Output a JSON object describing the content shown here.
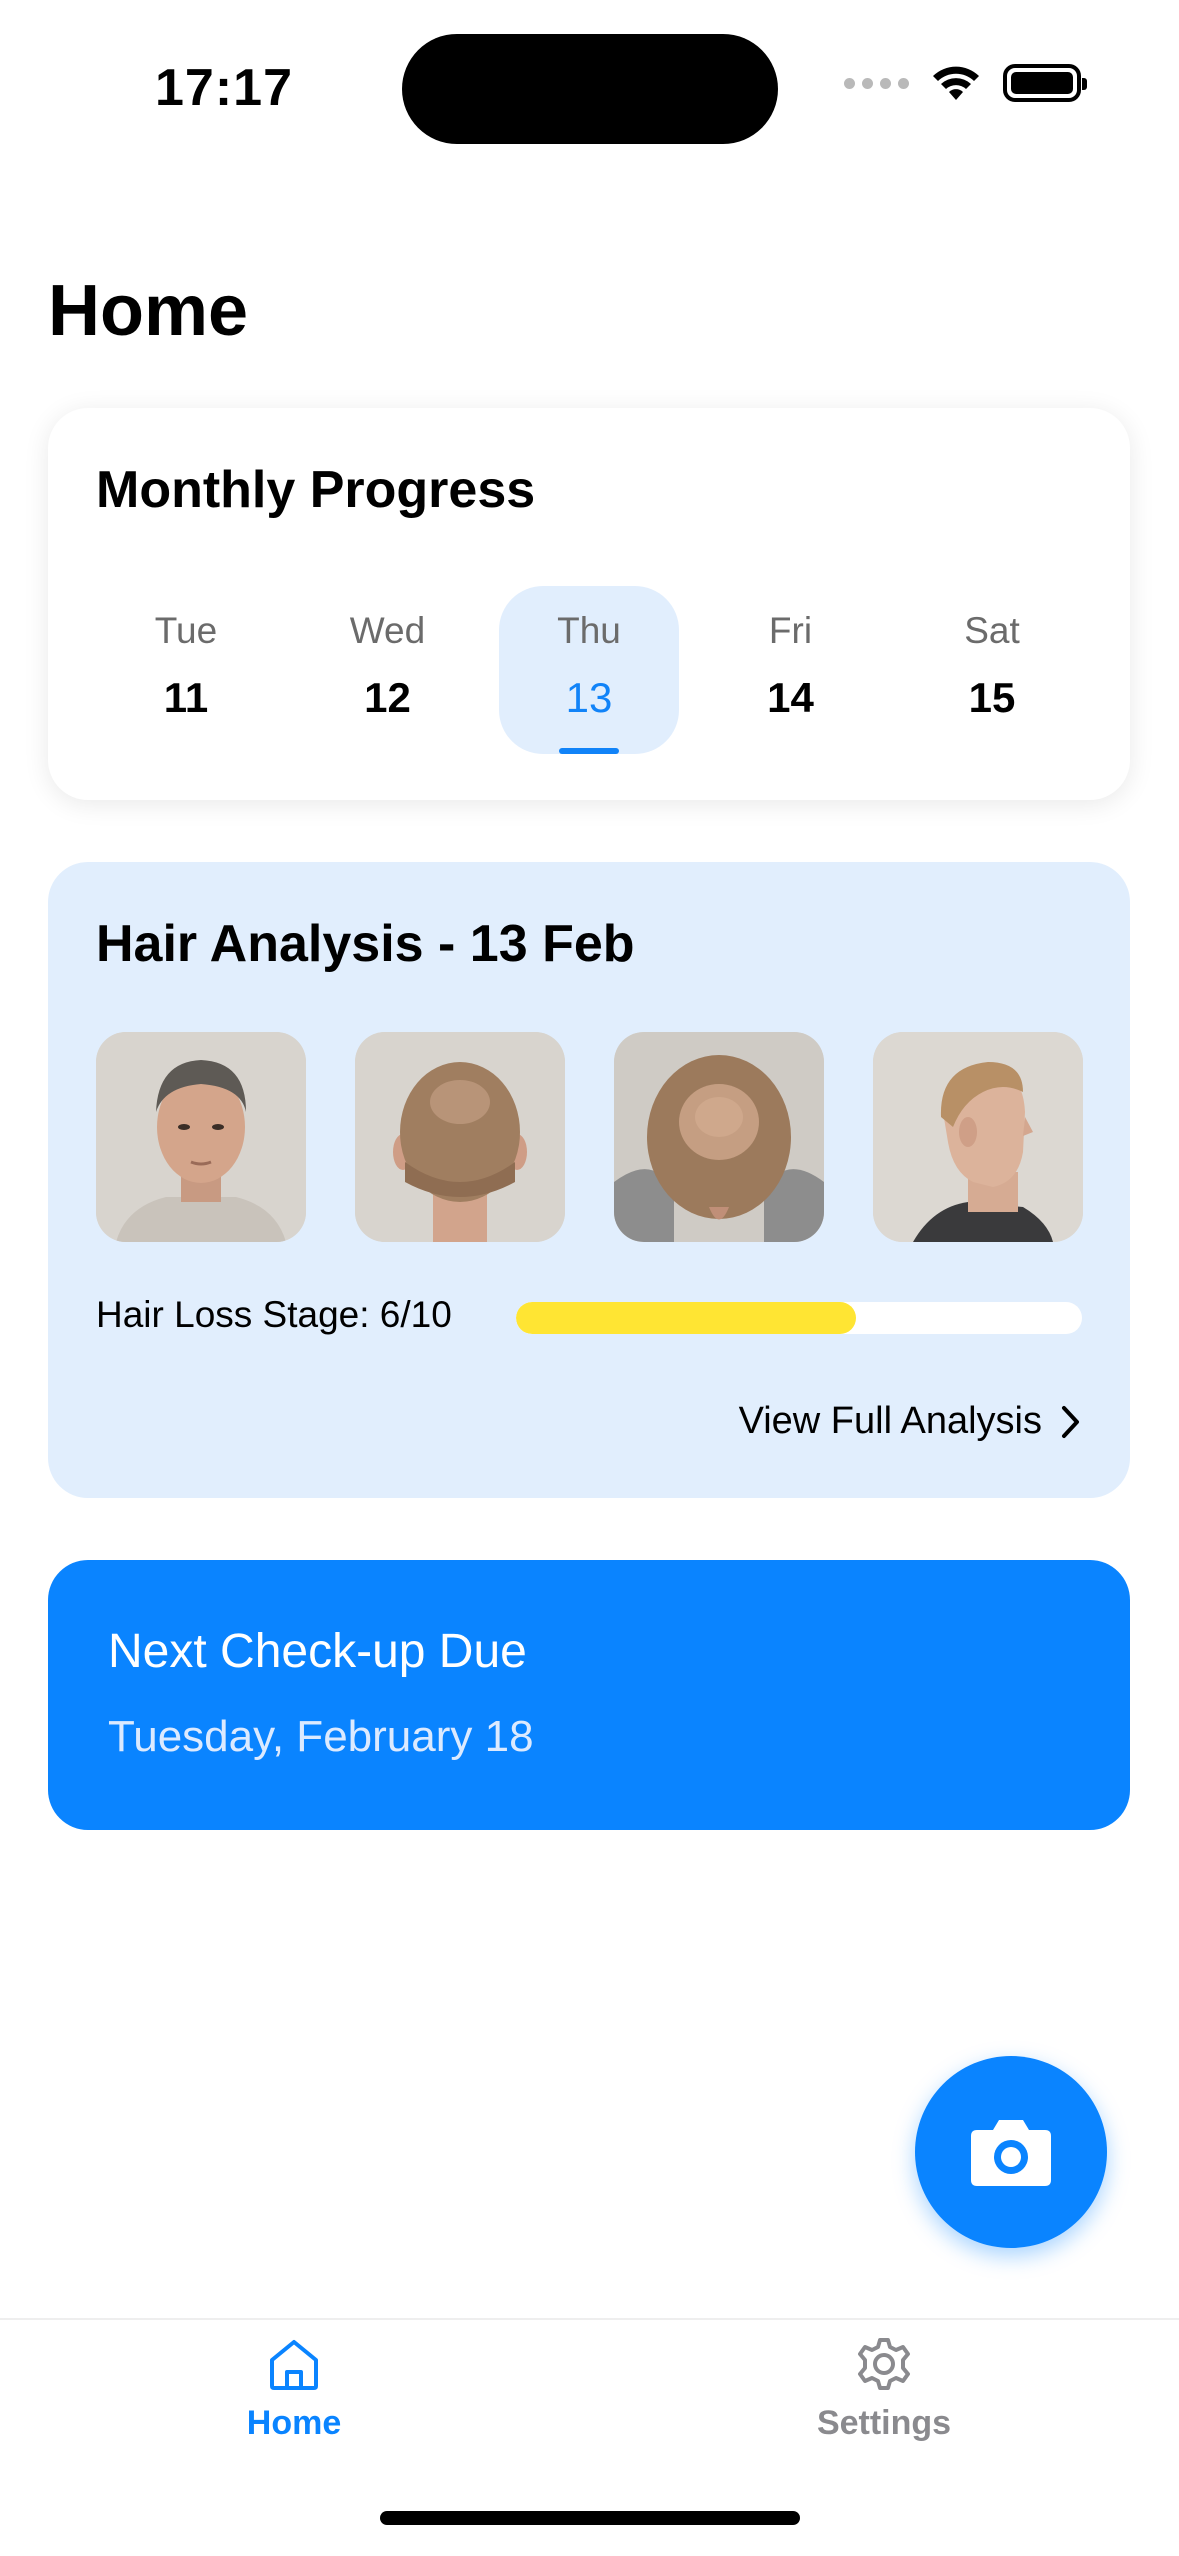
{
  "status_bar": {
    "time": "17:17"
  },
  "page": {
    "title": "Home"
  },
  "monthly_progress": {
    "title": "Monthly Progress",
    "days": [
      {
        "name": "Tue",
        "number": "11"
      },
      {
        "name": "Wed",
        "number": "12"
      },
      {
        "name": "Thu",
        "number": "13",
        "selected": true
      },
      {
        "name": "Fri",
        "number": "14"
      },
      {
        "name": "Sat",
        "number": "15"
      }
    ]
  },
  "hair_analysis": {
    "title": "Hair Analysis - 13 Feb",
    "photos": [
      "front-face-photo",
      "back-head-photo",
      "top-head-photo",
      "side-profile-photo"
    ],
    "stage_label": "Hair Loss Stage: 6/10",
    "stage_value": 6,
    "stage_max": 10,
    "stage_color": "#ffe533",
    "view_link": "View Full Analysis"
  },
  "checkup": {
    "title": "Next Check-up Due",
    "date": "Tuesday, February 18"
  },
  "fab": {
    "icon": "camera-icon"
  },
  "tabbar": {
    "items": [
      {
        "label": "Home",
        "icon": "home-icon",
        "active": true
      },
      {
        "label": "Settings",
        "icon": "gear-icon",
        "active": false
      }
    ]
  },
  "colors": {
    "accent": "#0a84ff",
    "card_tint": "#e1eefd"
  }
}
